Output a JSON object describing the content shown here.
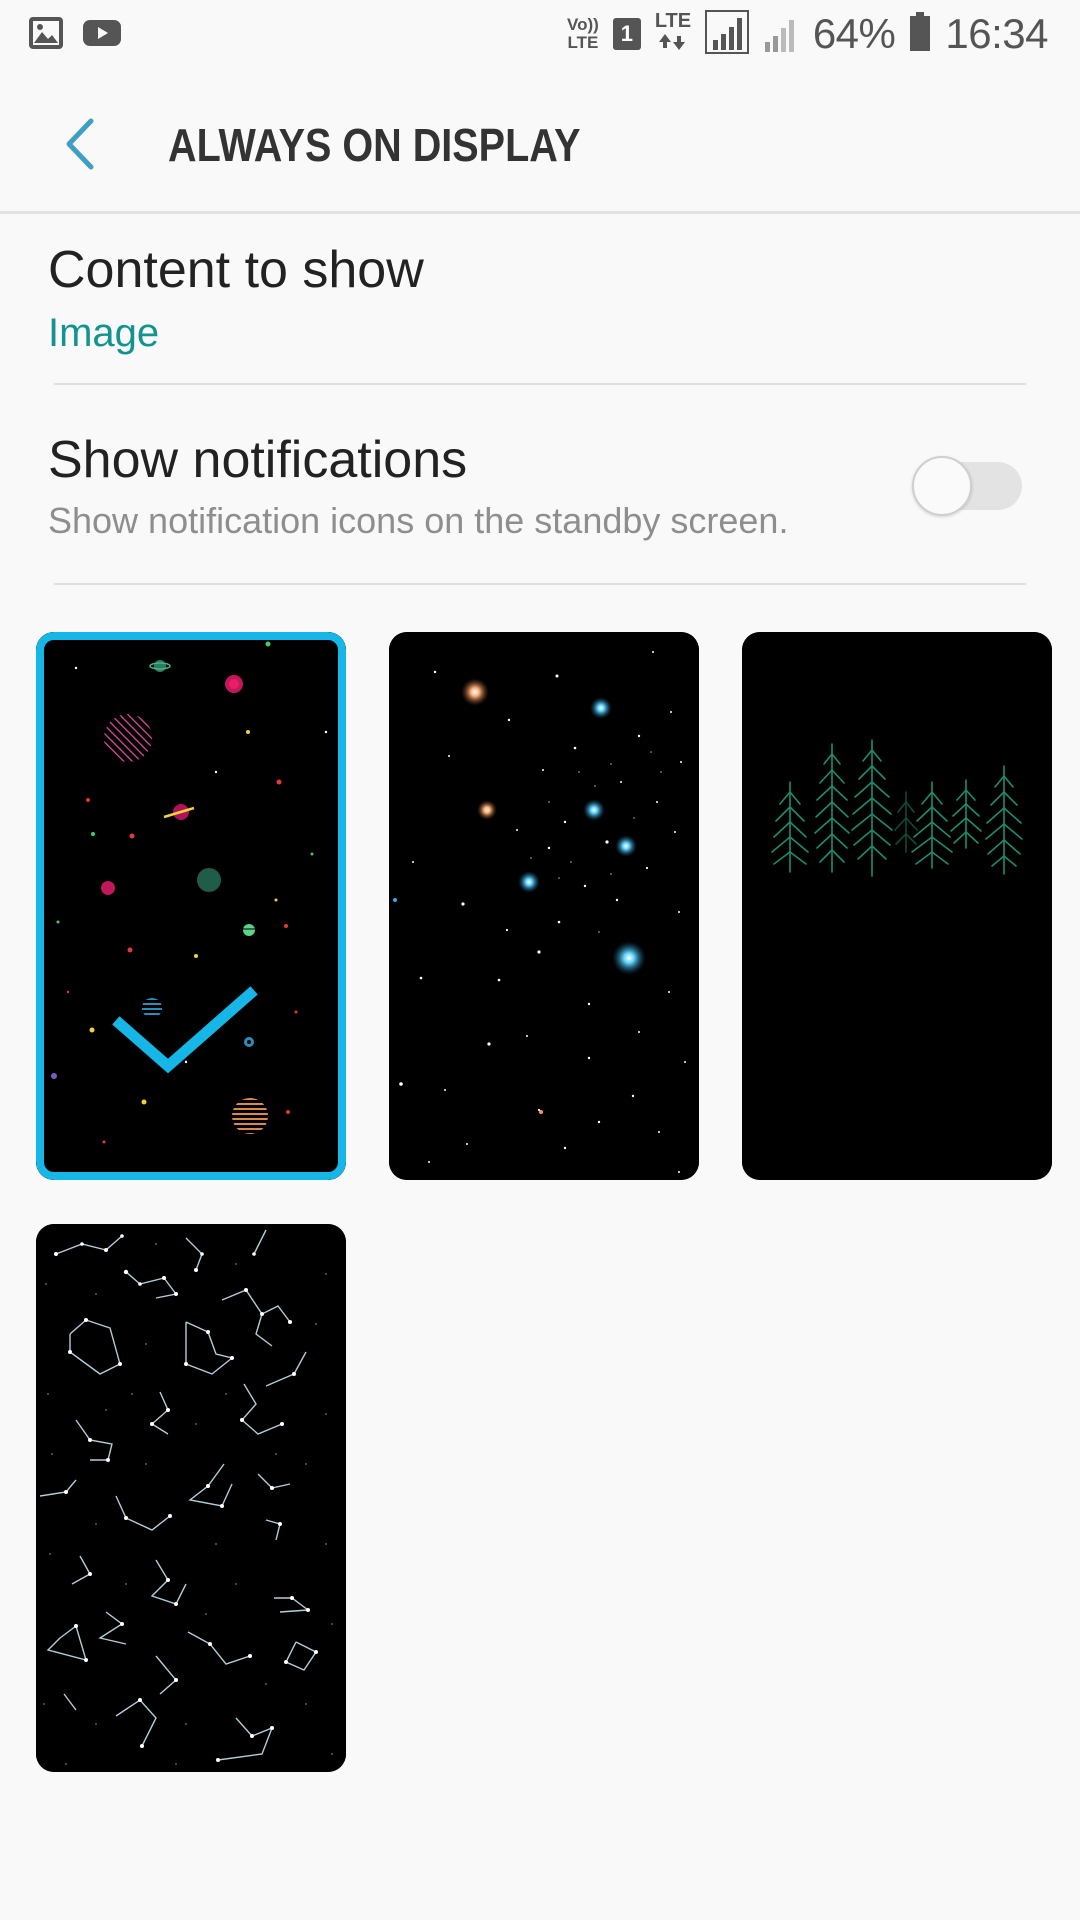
{
  "status_bar": {
    "volte_top": "Vo))",
    "volte_bottom": "LTE",
    "sim": "1",
    "network": "LTE",
    "battery": "64%",
    "time": "16:34",
    "left_icons": [
      "gallery-icon",
      "youtube-icon"
    ]
  },
  "header": {
    "title": "ALWAYS ON DISPLAY",
    "back_icon": "chevron-left-icon"
  },
  "content_to_show": {
    "title": "Content to show",
    "value": "Image"
  },
  "show_notifications": {
    "title": "Show notifications",
    "subtitle": "Show notification icons on the standby screen.",
    "enabled": false
  },
  "images": [
    {
      "id": "planets",
      "selected": true
    },
    {
      "id": "starfield",
      "selected": false
    },
    {
      "id": "forest",
      "selected": false
    },
    {
      "id": "constellations",
      "selected": false
    }
  ],
  "colors": {
    "accent": "#16b6e6",
    "value_text": "#12938f",
    "back_arrow": "#3d9fc4",
    "background": "#f9f9f9"
  }
}
